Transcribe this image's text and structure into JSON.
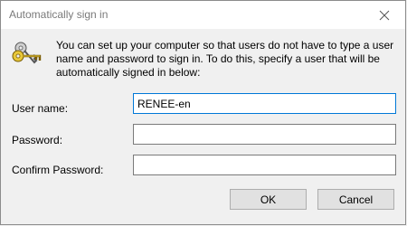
{
  "window": {
    "title": "Automatically sign in",
    "close_icon": "close-icon"
  },
  "header": {
    "icon": "keys-icon",
    "description": "You can set up your computer so that users do not have to type a user name and password to sign in. To do this, specify a user that will be automatically signed in below:"
  },
  "form": {
    "username_label": "User name:",
    "username_value": "RENEE-en",
    "password_label": "Password:",
    "password_value": "",
    "confirm_label": "Confirm Password:",
    "confirm_value": ""
  },
  "buttons": {
    "ok_label": "OK",
    "cancel_label": "Cancel"
  },
  "colors": {
    "titlebar": "#ffffff",
    "dialog_bg": "#f0f0f0",
    "title_text": "#7a7a7a",
    "button_bg": "#e1e1e1"
  }
}
